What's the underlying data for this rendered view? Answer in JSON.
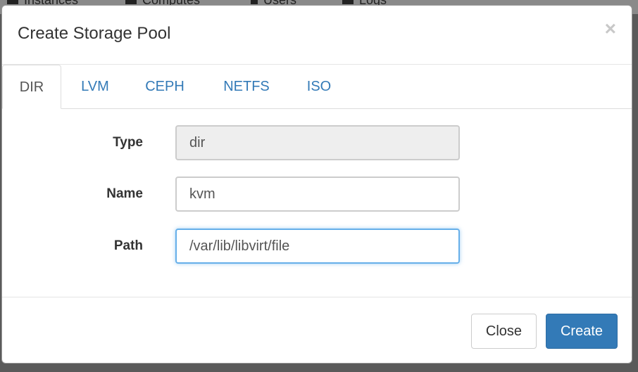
{
  "background_nav": {
    "items": [
      {
        "label": "Instances",
        "icon": "instances-icon"
      },
      {
        "label": "Computes",
        "icon": "computes-icon"
      },
      {
        "label": "Users",
        "icon": "users-icon"
      },
      {
        "label": "Logs",
        "icon": "logs-icon"
      }
    ]
  },
  "modal": {
    "title": "Create Storage Pool",
    "close_symbol": "×",
    "tabs": [
      {
        "label": "DIR",
        "active": true
      },
      {
        "label": "LVM",
        "active": false
      },
      {
        "label": "CEPH",
        "active": false
      },
      {
        "label": "NETFS",
        "active": false
      },
      {
        "label": "ISO",
        "active": false
      }
    ],
    "form": {
      "type_label": "Type",
      "type_value": "dir",
      "name_label": "Name",
      "name_value": "kvm",
      "path_label": "Path",
      "path_value": "/var/lib/libvirt/file"
    },
    "footer": {
      "close_label": "Close",
      "create_label": "Create"
    }
  },
  "colors": {
    "primary": "#337ab7",
    "link": "#337ab7",
    "focus_border": "#66afe9",
    "readonly_bg": "#eeeeee",
    "backdrop": "#5a5a5a"
  }
}
